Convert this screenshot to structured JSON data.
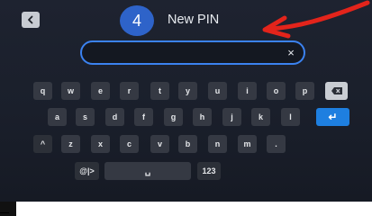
{
  "header": {
    "back_icon": "chevron-left-icon",
    "step_number": "4",
    "title": "New PIN"
  },
  "pin_input": {
    "value": "",
    "clear_icon": "close-icon",
    "clear_label": "×"
  },
  "keyboard": {
    "rows": [
      [
        {
          "label": "q"
        },
        {
          "label": "w"
        },
        {
          "label": "e"
        },
        {
          "label": "r"
        },
        {
          "label": "t"
        },
        {
          "label": "y"
        },
        {
          "label": "u"
        },
        {
          "label": "i"
        },
        {
          "label": "o"
        },
        {
          "label": "p"
        },
        {
          "label": "",
          "icon": "backspace-icon"
        }
      ],
      [
        {
          "label": "a"
        },
        {
          "label": "s"
        },
        {
          "label": "d"
        },
        {
          "label": "f"
        },
        {
          "label": "g"
        },
        {
          "label": "h"
        },
        {
          "label": "j"
        },
        {
          "label": "k"
        },
        {
          "label": "l"
        },
        {
          "label": "↵",
          "icon": "enter-icon"
        }
      ],
      [
        {
          "label": "^",
          "icon": "shift-icon"
        },
        {
          "label": "z"
        },
        {
          "label": "x"
        },
        {
          "label": "c"
        },
        {
          "label": "v"
        },
        {
          "label": "b"
        },
        {
          "label": "n"
        },
        {
          "label": "m"
        },
        {
          "label": "."
        }
      ],
      [
        {
          "label": "@|>",
          "icon": "symbols-icon"
        },
        {
          "label": "␣",
          "icon": "space-icon"
        },
        {
          "label": "123"
        }
      ]
    ]
  },
  "annotation": {
    "arrow_icon": "red-arrow-icon",
    "color": "#e3241b"
  },
  "colors": {
    "accent": "#3b82f0",
    "enter_key": "#1e7fe0",
    "badge": "#2e63c9"
  }
}
